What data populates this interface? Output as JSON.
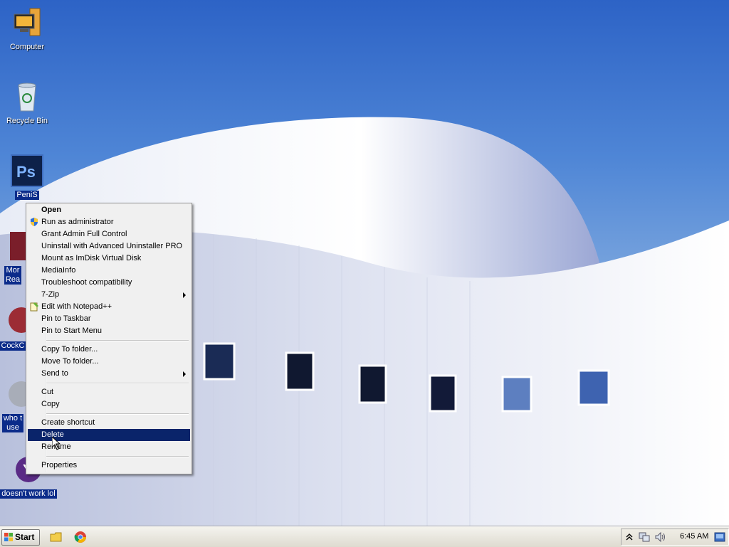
{
  "desktop": {
    "icons": [
      {
        "label": "Computer",
        "icon": "computer-icon"
      },
      {
        "label": "Recycle Bin",
        "icon": "recycle-bin-icon"
      },
      {
        "label": "PeniS",
        "icon": "photoshop-icon"
      },
      {
        "label": "Mor\nRea",
        "icon": "book-icon"
      },
      {
        "label": "CockC",
        "icon": "app-icon"
      },
      {
        "label": "who t\nuse",
        "icon": "app-icon"
      },
      {
        "label": "doesn't work lol",
        "icon": "yahoo-icon"
      }
    ]
  },
  "context_menu": {
    "items": [
      {
        "label": "Open",
        "bold": true
      },
      {
        "label": "Run as administrator",
        "icon": "uac-shield-icon"
      },
      {
        "label": "Grant Admin Full Control"
      },
      {
        "label": "Uninstall with Advanced Uninstaller PRO"
      },
      {
        "label": "Mount as ImDisk Virtual Disk"
      },
      {
        "label": "MediaInfo"
      },
      {
        "label": "Troubleshoot compatibility"
      },
      {
        "label": "7-Zip",
        "submenu": true
      },
      {
        "label": "Edit with Notepad++",
        "icon": "notepadpp-icon"
      },
      {
        "label": "Pin to Taskbar"
      },
      {
        "label": "Pin to Start Menu"
      },
      {
        "label": "Copy To folder..."
      },
      {
        "label": "Move To folder..."
      },
      {
        "label": "Send to",
        "submenu": true
      },
      {
        "label": "Cut"
      },
      {
        "label": "Copy"
      },
      {
        "label": "Create shortcut"
      },
      {
        "label": "Delete",
        "highlighted": true
      },
      {
        "label": "Rename"
      },
      {
        "label": "Properties"
      }
    ]
  },
  "taskbar": {
    "start_label": "Start",
    "pinned": [
      "explorer-icon",
      "chrome-icon"
    ],
    "tray_icons": [
      "show-hidden-icons-icon",
      "network-icon",
      "volume-icon",
      "action-center-icon"
    ],
    "clock": "6:45 AM"
  },
  "colors": {
    "highlight": "#0a246a",
    "menu_bg": "#f0f0f0",
    "taskbar_bg": "#ece9d8",
    "sky": "#4f86d6"
  }
}
